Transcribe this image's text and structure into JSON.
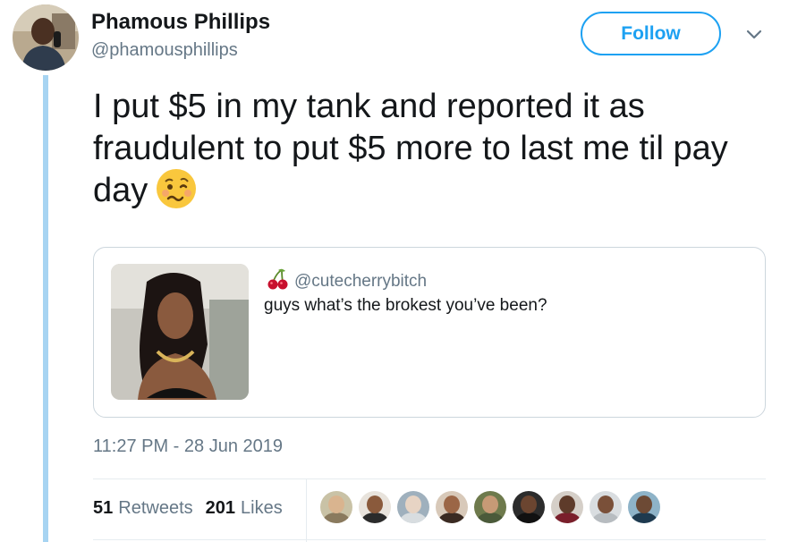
{
  "author": {
    "display_name": "Phamous Phillips",
    "handle": "@phamousphillips",
    "follow_label": "Follow"
  },
  "tweet": {
    "text": "I put $5 in my tank and reported it as fraudulent to put $5 more to last me til pay day",
    "emoji": "woozy-face",
    "timestamp": "11:27 PM - 28 Jun 2019"
  },
  "quoted_tweet": {
    "handle": "@cutecherrybitch",
    "handle_icon": "cherries-icon",
    "text": "guys what’s the brokest you’ve been?"
  },
  "stats": {
    "retweets_count": "51",
    "retweets_label": "Retweets",
    "likes_count": "201",
    "likes_label": "Likes"
  },
  "likers": [
    {
      "name": "liker-avatar-1",
      "bg": "#c9c2a6",
      "skin": "#d9b48f",
      "shirt": "#8a7a5e"
    },
    {
      "name": "liker-avatar-2",
      "bg": "#e8e3dc",
      "skin": "#8a5a3c",
      "shirt": "#2b2b2b"
    },
    {
      "name": "liker-avatar-3",
      "bg": "#9fb0bd",
      "skin": "#e7d4c4",
      "shirt": "#d8dde0"
    },
    {
      "name": "liker-avatar-4",
      "bg": "#d8c9b9",
      "skin": "#9b6646",
      "shirt": "#3a2a22"
    },
    {
      "name": "liker-avatar-5",
      "bg": "#6e7a4c",
      "skin": "#c79a76",
      "shirt": "#4b5a3a"
    },
    {
      "name": "liker-avatar-6",
      "bg": "#2c2c2c",
      "skin": "#6b4530",
      "shirt": "#111111"
    },
    {
      "name": "liker-avatar-7",
      "bg": "#d5cfc8",
      "skin": "#5e3b2a",
      "shirt": "#7a1f2b"
    },
    {
      "name": "liker-avatar-8",
      "bg": "#d9dde0",
      "skin": "#7a5039",
      "shirt": "#b7bcc0"
    },
    {
      "name": "liker-avatar-9",
      "bg": "#8eb3c8",
      "skin": "#6d4a35",
      "shirt": "#1e3a4f"
    }
  ],
  "colors": {
    "accent": "#1da1f2",
    "thread_line": "#a7d4f2",
    "muted_text": "#657786"
  }
}
